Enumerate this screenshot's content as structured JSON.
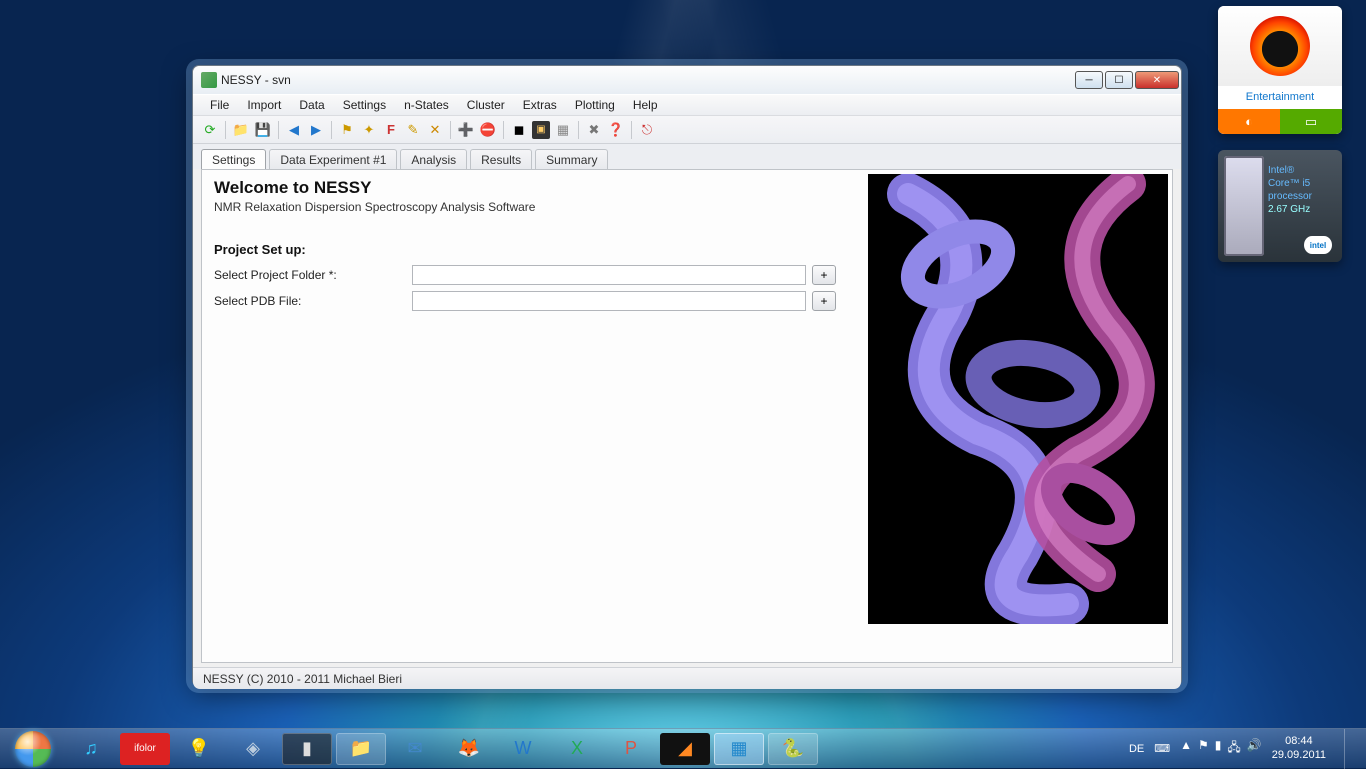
{
  "window": {
    "title": "NESSY - svn",
    "menu": [
      "File",
      "Import",
      "Data",
      "Settings",
      "n-States",
      "Cluster",
      "Extras",
      "Plotting",
      "Help"
    ],
    "tabs": [
      "Settings",
      "Data Experiment #1",
      "Analysis",
      "Results",
      "Summary"
    ],
    "active_tab": 0,
    "welcome_title": "Welcome to NESSY",
    "welcome_sub": "NMR Relaxation Dispersion Spectroscopy Analysis Software",
    "section_title": "Project Set up:",
    "fields": {
      "project_folder": {
        "label": "Select Project Folder *:",
        "value": "",
        "button": "+"
      },
      "pdb_file": {
        "label": "Select PDB File:",
        "value": "",
        "button": "+"
      }
    },
    "status": "NESSY (C) 2010 - 2011 Michael Bieri"
  },
  "gadgets": {
    "she_label": "Entertainment",
    "cpu": {
      "line1": "Intel®",
      "line2": "Core™ i5",
      "line3": "processor",
      "line4": "2.67 GHz",
      "badge": "intel"
    }
  },
  "taskbar": {
    "lang": "DE",
    "time": "08:44",
    "date": "29.09.2011"
  }
}
